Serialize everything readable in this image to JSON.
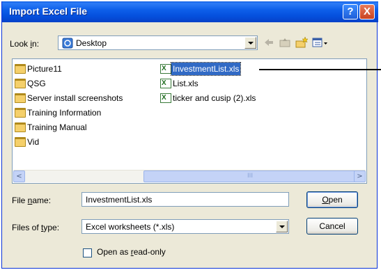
{
  "window": {
    "title": "Import Excel File",
    "help_glyph": "?",
    "close_glyph": "X"
  },
  "look_in": {
    "label_pre": "Look ",
    "label_key": "i",
    "label_post": "n:",
    "value": "Desktop"
  },
  "toolbar": {
    "icons": [
      "back-icon",
      "up-folder-icon",
      "new-folder-icon",
      "view-menu-icon"
    ]
  },
  "files": {
    "column1": [
      {
        "name": "Picture11",
        "type": "folder"
      },
      {
        "name": "QSG",
        "type": "folder"
      },
      {
        "name": "Server install screenshots",
        "type": "folder"
      },
      {
        "name": "Training Information",
        "type": "folder"
      },
      {
        "name": "Training Manual",
        "type": "folder"
      },
      {
        "name": "Vid",
        "type": "folder"
      }
    ],
    "column2": [
      {
        "name": "InvestmentList.xls",
        "type": "xls",
        "selected": true
      },
      {
        "name": "List.xls",
        "type": "xls"
      },
      {
        "name": "ticker and cusip (2).xls",
        "type": "xls"
      }
    ]
  },
  "scrollbar": {
    "left_glyph": "<",
    "right_glyph": ">",
    "grip": "III"
  },
  "file_name": {
    "label_pre": "File ",
    "label_key": "n",
    "label_post": "ame:",
    "value": "InvestmentList.xls"
  },
  "file_type": {
    "label_pre": "Files of ",
    "label_key": "t",
    "label_post": "ype:",
    "value": "Excel worksheets (*.xls)"
  },
  "buttons": {
    "open_key": "O",
    "open_rest": "pen",
    "cancel": "Cancel"
  },
  "readonly": {
    "label_pre": "Open as ",
    "label_key": "r",
    "label_post": "ead-only",
    "checked": false
  }
}
